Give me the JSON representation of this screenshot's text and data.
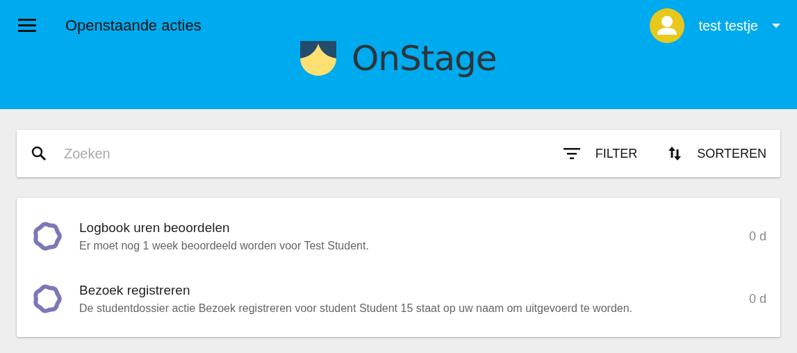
{
  "header": {
    "title": "Openstaande acties",
    "logo_text": "OnStage",
    "user_name": "test testje"
  },
  "search": {
    "placeholder": "Zoeken",
    "filter_label": "FILTER",
    "sort_label": "SORTEREN"
  },
  "actions": [
    {
      "title": "Logbook uren beoordelen",
      "description": "Er moet nog 1 week beoordeeld worden voor Test Student.",
      "age": "0 d"
    },
    {
      "title": "Bezoek registreren",
      "description": "De studentdossier actie Bezoek registreren voor student Student 15 staat op uw naam om uitgevoerd te worden.",
      "age": "0 d"
    }
  ]
}
